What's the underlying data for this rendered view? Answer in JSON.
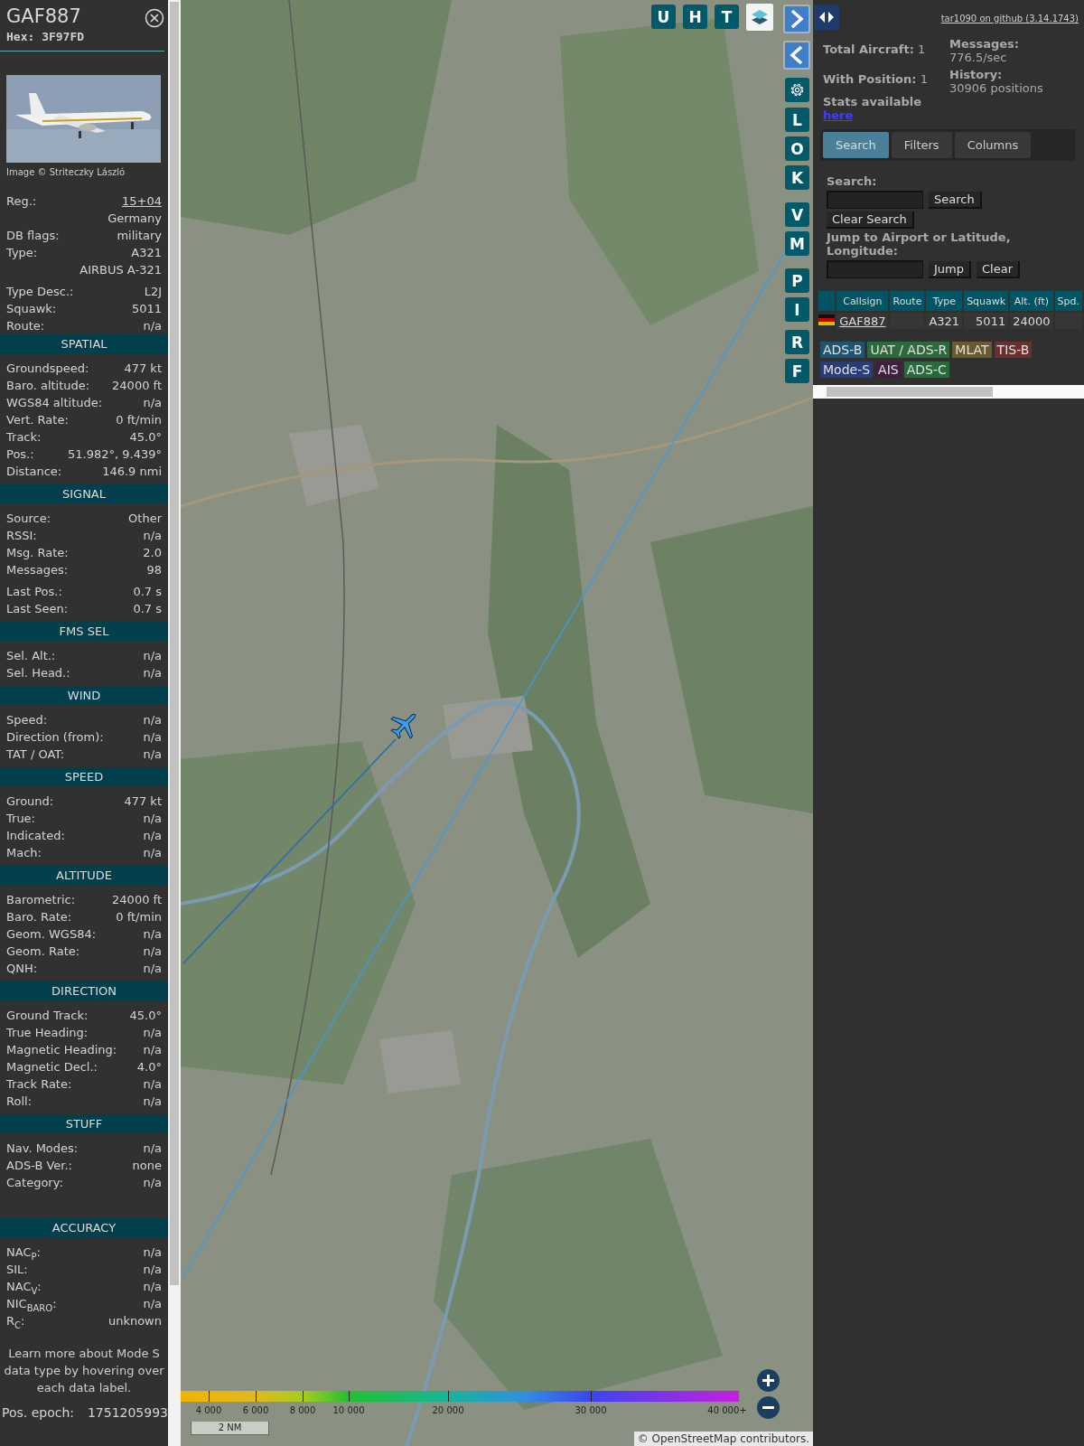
{
  "sidebar": {
    "callsign": "GAF887",
    "hex": "Hex: 3F97FD",
    "photo": {
      "kind": "picture"
    },
    "photo_credit": "Image © Striteczky László",
    "details": [
      {
        "label": "Reg.:",
        "value": "15+04",
        "kind": "link"
      },
      {
        "value": "Germany",
        "kind": "extra"
      },
      {
        "label": "DB flags:",
        "value": "military",
        "kind": "plain"
      },
      {
        "label": "Type:",
        "value": "A321",
        "kind": "plain"
      },
      {
        "value": "AIRBUS A-321",
        "kind": "extra"
      },
      {
        "label": "Type Desc.:",
        "value": "L2J",
        "kind": "spaced"
      },
      {
        "label": "Squawk:",
        "value": "5011",
        "kind": "plain"
      },
      {
        "label": "Route:",
        "value": "n/a",
        "kind": "plain"
      }
    ],
    "sections": [
      {
        "title": "SPATIAL",
        "rows": [
          {
            "label": "Groundspeed:",
            "value": "477 kt",
            "kind": "plain"
          },
          {
            "label": "Baro. altitude:",
            "value": "24000 ft",
            "kind": "plain"
          },
          {
            "label": "WGS84 altitude:",
            "value": "n/a",
            "kind": "plain"
          },
          {
            "label": "Vert. Rate:",
            "value": "0 ft/min",
            "kind": "plain"
          },
          {
            "label": "Track:",
            "value": "45.0°",
            "kind": "plain"
          },
          {
            "label": "Pos.:",
            "value": "51.982°, 9.439°",
            "kind": "plain"
          },
          {
            "label": "Distance:",
            "value": "146.9 nmi",
            "kind": "plain"
          }
        ]
      },
      {
        "title": "SIGNAL",
        "rows": [
          {
            "label": "Source:",
            "value": "Other",
            "kind": "plain"
          },
          {
            "label": "RSSI:",
            "value": "n/a",
            "kind": "plain"
          },
          {
            "label": "Msg. Rate:",
            "value": "2.0",
            "kind": "plain"
          },
          {
            "label": "Messages:",
            "value": "98",
            "kind": "plain"
          },
          {
            "label": "Last Pos.:",
            "value": "0.7 s",
            "kind": "spaced"
          },
          {
            "label": "Last Seen:",
            "value": "0.7 s",
            "kind": "plain"
          }
        ]
      },
      {
        "title": "FMS SEL",
        "rows": [
          {
            "label": "Sel. Alt.:",
            "value": "n/a",
            "kind": "plain"
          },
          {
            "label": "Sel. Head.:",
            "value": "n/a",
            "kind": "plain"
          }
        ]
      },
      {
        "title": "WIND",
        "rows": [
          {
            "label": "Speed:",
            "value": "n/a",
            "kind": "plain"
          },
          {
            "label": "Direction (from):",
            "value": "n/a",
            "kind": "plain"
          },
          {
            "label": "TAT / OAT:",
            "value": "n/a",
            "kind": "plain"
          }
        ]
      },
      {
        "title": "SPEED",
        "rows": [
          {
            "label": "Ground:",
            "value": "477 kt",
            "kind": "plain"
          },
          {
            "label": "True:",
            "value": "n/a",
            "kind": "plain"
          },
          {
            "label": "Indicated:",
            "value": "n/a",
            "kind": "plain"
          },
          {
            "label": "Mach:",
            "value": "n/a",
            "kind": "plain"
          }
        ]
      },
      {
        "title": "ALTITUDE",
        "rows": [
          {
            "label": "Barometric:",
            "value": "24000 ft",
            "kind": "plain"
          },
          {
            "label": "Baro. Rate:",
            "value": "0 ft/min",
            "kind": "plain"
          },
          {
            "label": "Geom. WGS84:",
            "value": "n/a",
            "kind": "plain"
          },
          {
            "label": "Geom. Rate:",
            "value": "n/a",
            "kind": "plain"
          },
          {
            "label": "QNH:",
            "value": "n/a",
            "kind": "plain"
          }
        ]
      },
      {
        "title": "DIRECTION",
        "rows": [
          {
            "label": "Ground Track:",
            "value": "45.0°",
            "kind": "plain"
          },
          {
            "label": "True Heading:",
            "value": "n/a",
            "kind": "plain"
          },
          {
            "label": "Magnetic Heading:",
            "value": "n/a",
            "kind": "plain"
          },
          {
            "label": "Magnetic Decl.:",
            "value": "4.0°",
            "kind": "plain"
          },
          {
            "label": "Track Rate:",
            "value": "n/a",
            "kind": "plain"
          },
          {
            "label": "Roll:",
            "value": "n/a",
            "kind": "plain"
          }
        ]
      },
      {
        "title": "STUFF",
        "rows": [
          {
            "label": "Nav. Modes:",
            "value": "n/a",
            "kind": "plain"
          },
          {
            "label": "ADS-B Ver.:",
            "value": "none",
            "kind": "plain"
          },
          {
            "label": "Category:",
            "value": "n/a",
            "kind": "plain"
          }
        ]
      },
      {
        "title": "ACCURACY",
        "rows": [
          {
            "label": "NAC$_{P}$:",
            "value": "n/a",
            "kind": "plain"
          },
          {
            "label": "SIL:",
            "value": "n/a",
            "kind": "plain"
          },
          {
            "label": "NAC$_{V}$:",
            "value": "n/a",
            "kind": "plain"
          },
          {
            "label": "NIC$_{BARO}$:",
            "value": "n/a",
            "kind": "plain"
          },
          {
            "label": "R$_{C}$:",
            "value": "unknown",
            "kind": "plain"
          }
        ]
      }
    ],
    "note": "Learn more about Mode S data type by hovering over each data label.",
    "epoch": {
      "label": "Pos. epoch:",
      "value": "1751205993"
    }
  },
  "map": {
    "map_image": {
      "kind": "picture"
    },
    "top_buttons": [
      "U",
      "H",
      "T"
    ],
    "side_buttons": [
      "L",
      "O",
      "K",
      "V",
      "M",
      "P",
      "I",
      "R",
      "F"
    ],
    "altitude_legend": [
      "4 000",
      "6 000",
      "8 000",
      "10 000",
      "20 000",
      "30 000",
      "40 000+"
    ],
    "scale": "2 NM",
    "attribution": {
      "prefix": "©",
      "link": "OpenStreetMap",
      "suffix": "contributors."
    }
  },
  "panel": {
    "version_link": "tar1090 on github (3.14.1743)",
    "stats_left": [
      "**Total Aircraft:** 1",
      "**With Position:** 1"
    ],
    "stats_link_label": "Stats available",
    "stats_link": "here",
    "stats_right": [
      {
        "label": "Messages:",
        "value": "776.5/sec"
      },
      {
        "label": "History:",
        "value": "30906 positions"
      }
    ],
    "tabs": [
      {
        "label": "Search",
        "selected": true
      },
      {
        "label": "Filters",
        "selected": false
      },
      {
        "label": "Columns",
        "selected": false
      }
    ],
    "search_label": "Search:",
    "search_button": "Search",
    "clear_search_button": "Clear Search",
    "jump_label": "Jump to Airport or Latitude, Longitude:",
    "jump_button": "Jump",
    "clear_button": "Clear",
    "table": {
      "columns": [
        "Callsign",
        "Route",
        "Type",
        "Squawk",
        "Alt. (ft)",
        "Spd."
      ],
      "rows": [
        {
          "callsign": "GAF887",
          "type": "A321",
          "squawk": "5011",
          "altitude": "24000"
        }
      ]
    },
    "legend": [
      {
        "label": "ADS-B",
        "color": "#1f5470"
      },
      {
        "label": "UAT / ADS-R",
        "color": "#2c6a3c"
      },
      {
        "label": "MLAT",
        "color": "#6a5a30"
      },
      {
        "label": "TIS-B",
        "color": "#6a3030"
      },
      {
        "label": "Mode-S",
        "color": "#283c78"
      },
      {
        "label": "AIS",
        "color": "#3e1f3e"
      },
      {
        "label": "ADS-C",
        "color": "#276b3c"
      }
    ]
  }
}
